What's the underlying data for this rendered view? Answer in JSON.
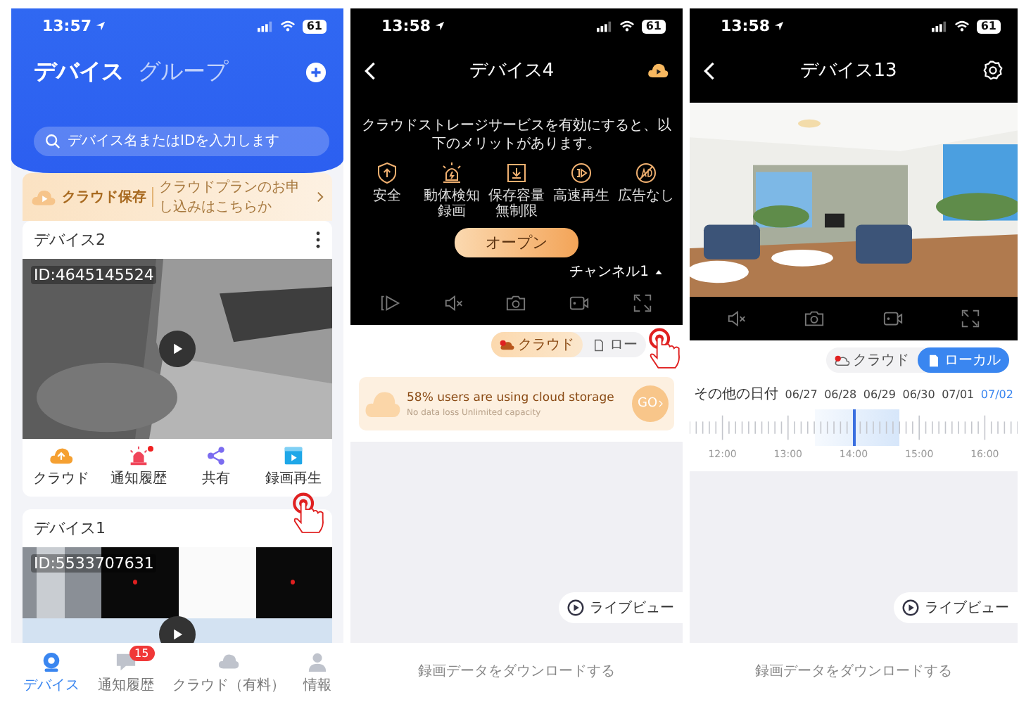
{
  "device_list_screen": {
    "status_bar": {
      "time": "13:57",
      "battery": "61"
    },
    "tabs": [
      {
        "label": "デバイス",
        "selected": true
      },
      {
        "label": "グループ",
        "selected": false
      }
    ],
    "search": {
      "placeholder": "デバイス名またはIDを入力します"
    },
    "cloud_banner": {
      "title": "クラウド保存",
      "text": "クラウドプランのお申し込みはこちらか"
    },
    "devices": [
      {
        "name": "デバイス2",
        "id": "ID:4645145524",
        "actions": [
          {
            "kind": "cloud",
            "label": "クラウド",
            "dot": false
          },
          {
            "kind": "alarm",
            "label": "通知履歴",
            "dot": true
          },
          {
            "kind": "share",
            "label": "共有",
            "dot": false
          },
          {
            "kind": "playback",
            "label": "録画再生",
            "dot": false
          }
        ]
      },
      {
        "name": "デバイス1",
        "id": "ID:5533707631"
      }
    ],
    "bottom_nav": [
      {
        "kind": "device",
        "label": "デバイス",
        "selected": true
      },
      {
        "kind": "message",
        "label": "通知履歴",
        "selected": false,
        "badge": "15"
      },
      {
        "kind": "cloud",
        "label": "クラウド（有料）",
        "selected": false
      },
      {
        "kind": "profile",
        "label": "情報",
        "selected": false
      }
    ]
  },
  "cloud_screen": {
    "status_bar": {
      "time": "13:58",
      "battery": "61"
    },
    "title": "デバイス4",
    "promo_text": "クラウドストレージサービスを有効にすると、以下のメリットがあります。",
    "benefits": [
      {
        "kind": "security",
        "label": "安全"
      },
      {
        "kind": "motion",
        "label": "動体検知録画"
      },
      {
        "kind": "storage",
        "label": "保存容量無制限"
      },
      {
        "kind": "fast",
        "label": "高速再生"
      },
      {
        "kind": "noads",
        "label": "広告なし"
      }
    ],
    "open_button": "オープン",
    "channel": "チャンネル1",
    "source_toggle": [
      {
        "kind": "cloud",
        "label": "クラウド",
        "selected": true
      },
      {
        "kind": "local",
        "label": "ロー",
        "selected": false
      }
    ],
    "storage_banner": {
      "title": "58% users are using cloud storage",
      "subtitle": "No data loss Unlimited capacity",
      "button": "GO"
    },
    "live_view": "ライブビュー",
    "download": "録画データをダウンロードする"
  },
  "playback_screen": {
    "status_bar": {
      "time": "13:58",
      "battery": "61"
    },
    "title": "デバイス13",
    "source_toggle": [
      {
        "kind": "cloud",
        "label": "クラウド",
        "selected": false
      },
      {
        "kind": "local",
        "label": "ローカル",
        "selected": true
      }
    ],
    "other_dates": "その他の日付",
    "dates": [
      {
        "label": "06/27",
        "selected": false
      },
      {
        "label": "06/28",
        "selected": false
      },
      {
        "label": "06/29",
        "selected": false
      },
      {
        "label": "06/30",
        "selected": false
      },
      {
        "label": "07/01",
        "selected": false
      },
      {
        "label": "07/02",
        "selected": true
      }
    ],
    "timeline_labels": [
      "12:00",
      "13:00",
      "14:00",
      "15:00",
      "16:00"
    ],
    "live_view": "ライブビュー",
    "download": "録画データをダウンロードする"
  }
}
